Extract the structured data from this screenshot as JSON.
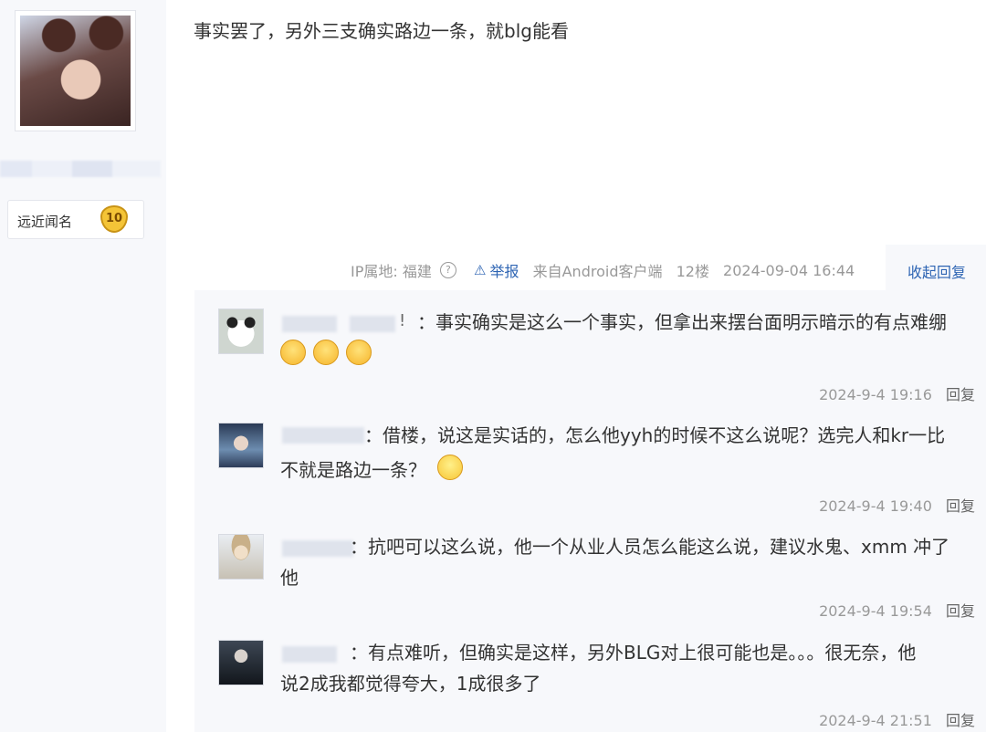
{
  "author": {
    "avatar": "avatar-portrait",
    "badge_label": "远近闻名",
    "badge_level": "10"
  },
  "post": {
    "content": "事实罢了，另外三支确实路边一条，就blg能看",
    "ip_label": "IP属地: 福建",
    "help_icon": "?",
    "report_icon": "⚠",
    "report_label": "举报",
    "source": "来自Android客户端",
    "floor": "12楼",
    "timestamp": "2024-09-04 16:44",
    "collapse_label": "收起回复"
  },
  "replies": [
    {
      "avatar": "panda",
      "name_suffix": "!",
      "text": "：事实确实是这么一个事实，但拿出来摆台面明示暗示的有点难绷",
      "emojis": [
        "angry-face-icon",
        "angry-face-icon",
        "angry-face-icon"
      ],
      "time": "2024-9-4 19:16",
      "reply_label": "回复"
    },
    {
      "avatar": "anime-boy",
      "text_line1": "：借楼，说这是实话的，怎么他yyh的时候不这么说呢？选完人和kr一比",
      "text_line2": "不就是路边一条？",
      "emoji": "smile-face-icon",
      "time": "2024-9-4 19:40",
      "reply_label": "回复"
    },
    {
      "avatar": "girl-hat",
      "text_line1": "：抗吧可以这么说，他一个从业人员怎么能这么说，建议水鬼、xmm 冲了",
      "text_line2": "他",
      "time": "2024-9-4 19:54",
      "reply_label": "回复"
    },
    {
      "avatar": "dark-character",
      "text_line1": "：有点难听，但确实是这样，另外BLG对上很可能也是。。。很无奈，他",
      "text_line2": "说2成我都觉得夸大，1成很多了",
      "time": "2024-9-4 21:51",
      "reply_label": "回复"
    }
  ],
  "colors": {
    "link": "#2d64b3",
    "meta": "#999999",
    "panel": "#f7f8fb",
    "badge": "#f4c437"
  }
}
